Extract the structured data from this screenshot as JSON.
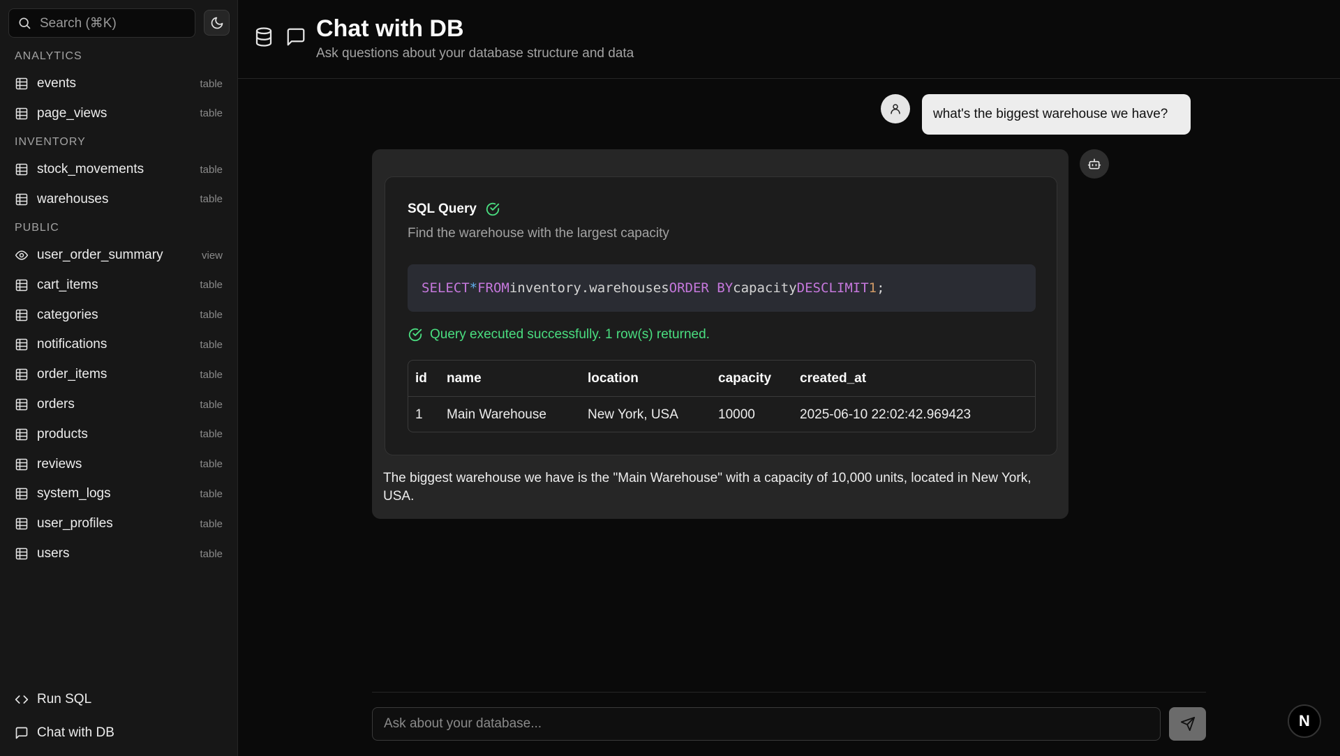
{
  "sidebar": {
    "search_placeholder": "Search (⌘K)",
    "sections": [
      {
        "label": "ANALYTICS",
        "items": [
          {
            "name": "events",
            "kind": "table"
          },
          {
            "name": "page_views",
            "kind": "table"
          }
        ]
      },
      {
        "label": "INVENTORY",
        "items": [
          {
            "name": "stock_movements",
            "kind": "table"
          },
          {
            "name": "warehouses",
            "kind": "table"
          }
        ]
      },
      {
        "label": "PUBLIC",
        "items": [
          {
            "name": "user_order_summary",
            "kind": "view"
          },
          {
            "name": "cart_items",
            "kind": "table"
          },
          {
            "name": "categories",
            "kind": "table"
          },
          {
            "name": "notifications",
            "kind": "table"
          },
          {
            "name": "order_items",
            "kind": "table"
          },
          {
            "name": "orders",
            "kind": "table"
          },
          {
            "name": "products",
            "kind": "table"
          },
          {
            "name": "reviews",
            "kind": "table"
          },
          {
            "name": "system_logs",
            "kind": "table"
          },
          {
            "name": "user_profiles",
            "kind": "table"
          },
          {
            "name": "users",
            "kind": "table"
          }
        ]
      }
    ],
    "bottom": {
      "run_sql": "Run SQL",
      "chat_with_db": "Chat with DB"
    }
  },
  "header": {
    "title": "Chat with DB",
    "subtitle": "Ask questions about your database structure and data"
  },
  "chat": {
    "user_message": "what's the biggest warehouse we have?",
    "sql_card": {
      "title": "SQL Query",
      "description": "Find the warehouse with the largest capacity",
      "code": {
        "select": "SELECT",
        "star": "*",
        "from": "FROM",
        "table": "inventory.warehouses",
        "order_by": "ORDER BY",
        "column": "capacity",
        "desc": "DESC",
        "limit": "LIMIT",
        "limit_value": "1",
        "terminator": ";"
      },
      "status": "Query executed successfully. 1 row(s) returned.",
      "columns": [
        "id",
        "name",
        "location",
        "capacity",
        "created_at"
      ],
      "rows": [
        [
          "1",
          "Main Warehouse",
          "New York, USA",
          "10000",
          "2025-06-10 22:02:42.969423"
        ]
      ]
    },
    "answer": "The biggest warehouse we have is the \"Main Warehouse\" with a capacity of 10,000 units, located in New York, USA."
  },
  "composer": {
    "placeholder": "Ask about your database..."
  },
  "badge": {
    "letter": "N"
  },
  "icons": {
    "search": "search-icon",
    "theme": "moon-icon",
    "table": "table-icon",
    "view": "eye-icon",
    "code": "code-icon",
    "chat": "message-square-icon",
    "database": "database-icon",
    "user": "user-icon",
    "bot": "bot-icon",
    "check": "check-circle-icon",
    "send": "send-icon"
  },
  "colors": {
    "success": "#4ade80",
    "keyword": "#c678dd",
    "number": "#d19a66"
  }
}
